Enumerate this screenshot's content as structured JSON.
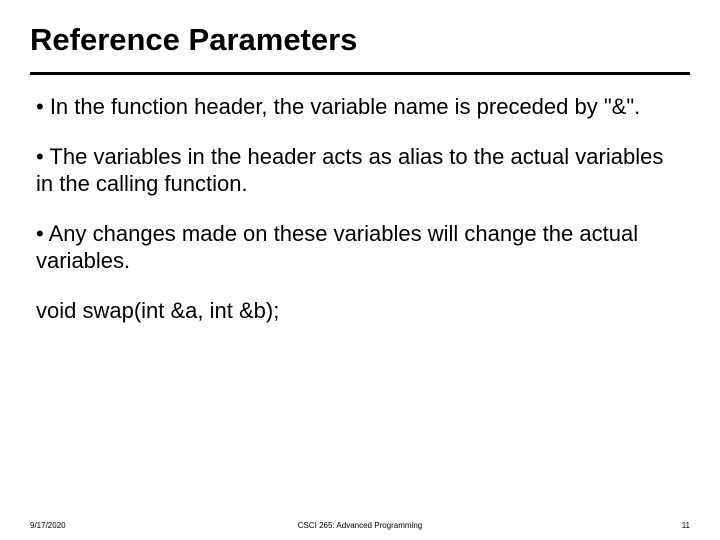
{
  "slide": {
    "title": "Reference Parameters",
    "bullets": [
      "• In the function header, the variable name is preceded by \"&\".",
      "• The variables in the header acts as alias to the actual variables in the calling function.",
      "• Any changes made on these variables will change the actual variables."
    ],
    "code_line": "void swap(int &a, int &b);"
  },
  "footer": {
    "date": "9/17/2020",
    "course": "CSCI 265: Advanced Programming",
    "page": "11"
  }
}
